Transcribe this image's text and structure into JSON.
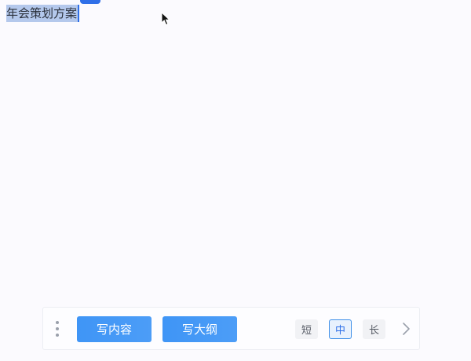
{
  "editor": {
    "selected_text": "年会策划方案"
  },
  "toolbar": {
    "write_content_label": "写内容",
    "write_outline_label": "写大纲",
    "length_options": {
      "short": "短",
      "medium": "中",
      "long": "长"
    },
    "selected_length": "中",
    "icons": {
      "handle": "more-vertical-icon",
      "next": "chevron-right-icon"
    }
  },
  "colors": {
    "background": "#fbfafe",
    "selection": "#b4c8ec",
    "caret": "#2f6fe8",
    "primary_button": "#4c9df7",
    "selected_option_border": "#3e8fe8"
  }
}
